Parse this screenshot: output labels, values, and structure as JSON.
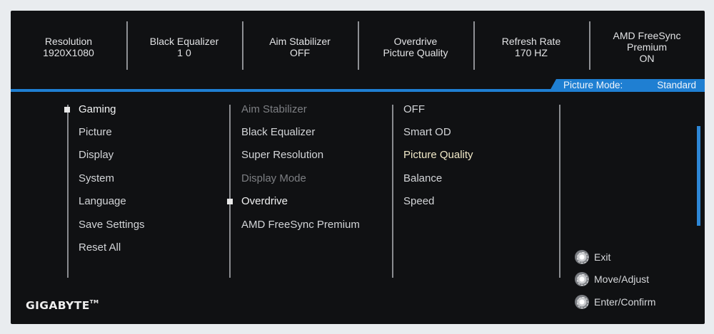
{
  "status": [
    {
      "lines": [
        "Resolution",
        "1920X1080"
      ]
    },
    {
      "lines": [
        "Black Equalizer",
        "1 0"
      ]
    },
    {
      "lines": [
        "Aim Stabilizer",
        "OFF"
      ]
    },
    {
      "lines": [
        "Overdrive",
        "Picture Quality"
      ]
    },
    {
      "lines": [
        "Refresh Rate",
        "170 HZ"
      ]
    },
    {
      "lines": [
        "AMD FreeSync",
        "Premium",
        "ON"
      ]
    }
  ],
  "picture_mode": {
    "label": "Picture Mode:",
    "value": "Standard"
  },
  "main_menu": {
    "items": [
      "Gaming",
      "Picture",
      "Display",
      "System",
      "Language",
      "Save Settings",
      "Reset All"
    ],
    "selected_index": 0
  },
  "sub_menu": {
    "items": [
      "Aim Stabilizer",
      "Black Equalizer",
      "Super Resolution",
      "Display Mode",
      "Overdrive",
      "AMD FreeSync Premium"
    ],
    "dimmed": [
      0,
      3
    ],
    "selected_index": 4
  },
  "options": {
    "items": [
      "OFF",
      "Smart OD",
      "Picture Quality",
      "Balance",
      "Speed"
    ],
    "active_index": 2
  },
  "help": [
    {
      "icon": "joystick-icon",
      "label": "Exit"
    },
    {
      "icon": "joystick-icon",
      "label": "Move/Adjust"
    },
    {
      "icon": "joystick-icon",
      "label": "Enter/Confirm"
    }
  ],
  "brand": {
    "name": "GIGABYTE",
    "mark": "TM"
  },
  "colors": {
    "accent": "#1f7fd2",
    "background": "#101113"
  }
}
